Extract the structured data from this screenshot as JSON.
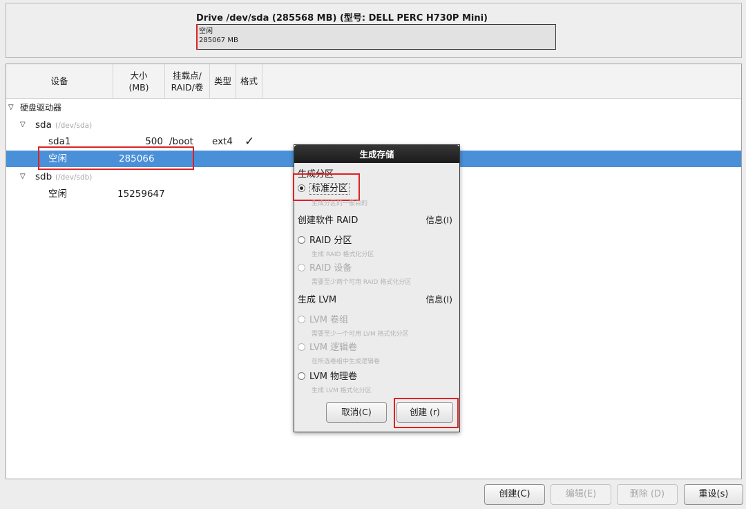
{
  "drive": {
    "title": "Drive /dev/sda (285568 MB) (型号: DELL PERC H730P Mini)",
    "bar_label": "空闲",
    "bar_size": "285067 MB"
  },
  "table": {
    "headers": [
      "设备",
      "大小\n(MB)",
      "挂载点/\nRAID/卷",
      "类型",
      "格式"
    ],
    "group_label": "硬盘驱动器",
    "disks": [
      {
        "name": "sda",
        "path": "(/dev/sda)",
        "partitions": [
          {
            "name": "sda1",
            "size": "500",
            "mount": "/boot",
            "type": "ext4",
            "format": "✓"
          },
          {
            "name": "空闲",
            "size": "285066",
            "mount": "",
            "type": "",
            "format": ""
          }
        ]
      },
      {
        "name": "sdb",
        "path": "(/dev/sdb)",
        "partitions": [
          {
            "name": "空闲",
            "size": "15259647",
            "mount": "",
            "type": "",
            "format": ""
          }
        ]
      }
    ]
  },
  "dialog": {
    "title": "生成存储",
    "section_partition": "生成分区",
    "opt_standard": "标准分区",
    "opt_standard_desc": "生成分区的一般目的",
    "section_raid": "创建软件 RAID",
    "info_raid": "信息(I)",
    "opt_raid_partition": "RAID 分区",
    "opt_raid_partition_desc": "生成 RAID 格式化分区",
    "opt_raid_device": "RAID 设备",
    "opt_raid_device_desc": "需要至少两个可用 RAID 格式化分区",
    "section_lvm": "生成 LVM",
    "info_lvm": "信息(I)",
    "opt_lvm_vg": "LVM 卷组",
    "opt_lvm_vg_desc": "需要至少一个可用 LVM 格式化分区",
    "opt_lvm_lv": "LVM 逻辑卷",
    "opt_lvm_lv_desc": "在所选卷组中生成逻辑卷",
    "opt_lvm_pv": "LVM 物理卷",
    "opt_lvm_pv_desc": "生成 LVM 格式化分区",
    "cancel": "取消(C)",
    "create": "创建 (r)"
  },
  "buttons": {
    "create": "创建(C)",
    "edit": "编辑(E)",
    "delete": "删除 (D)",
    "reset": "重设(s)"
  },
  "colors": {
    "selection": "#4a90d9",
    "highlight": "#e02020"
  }
}
